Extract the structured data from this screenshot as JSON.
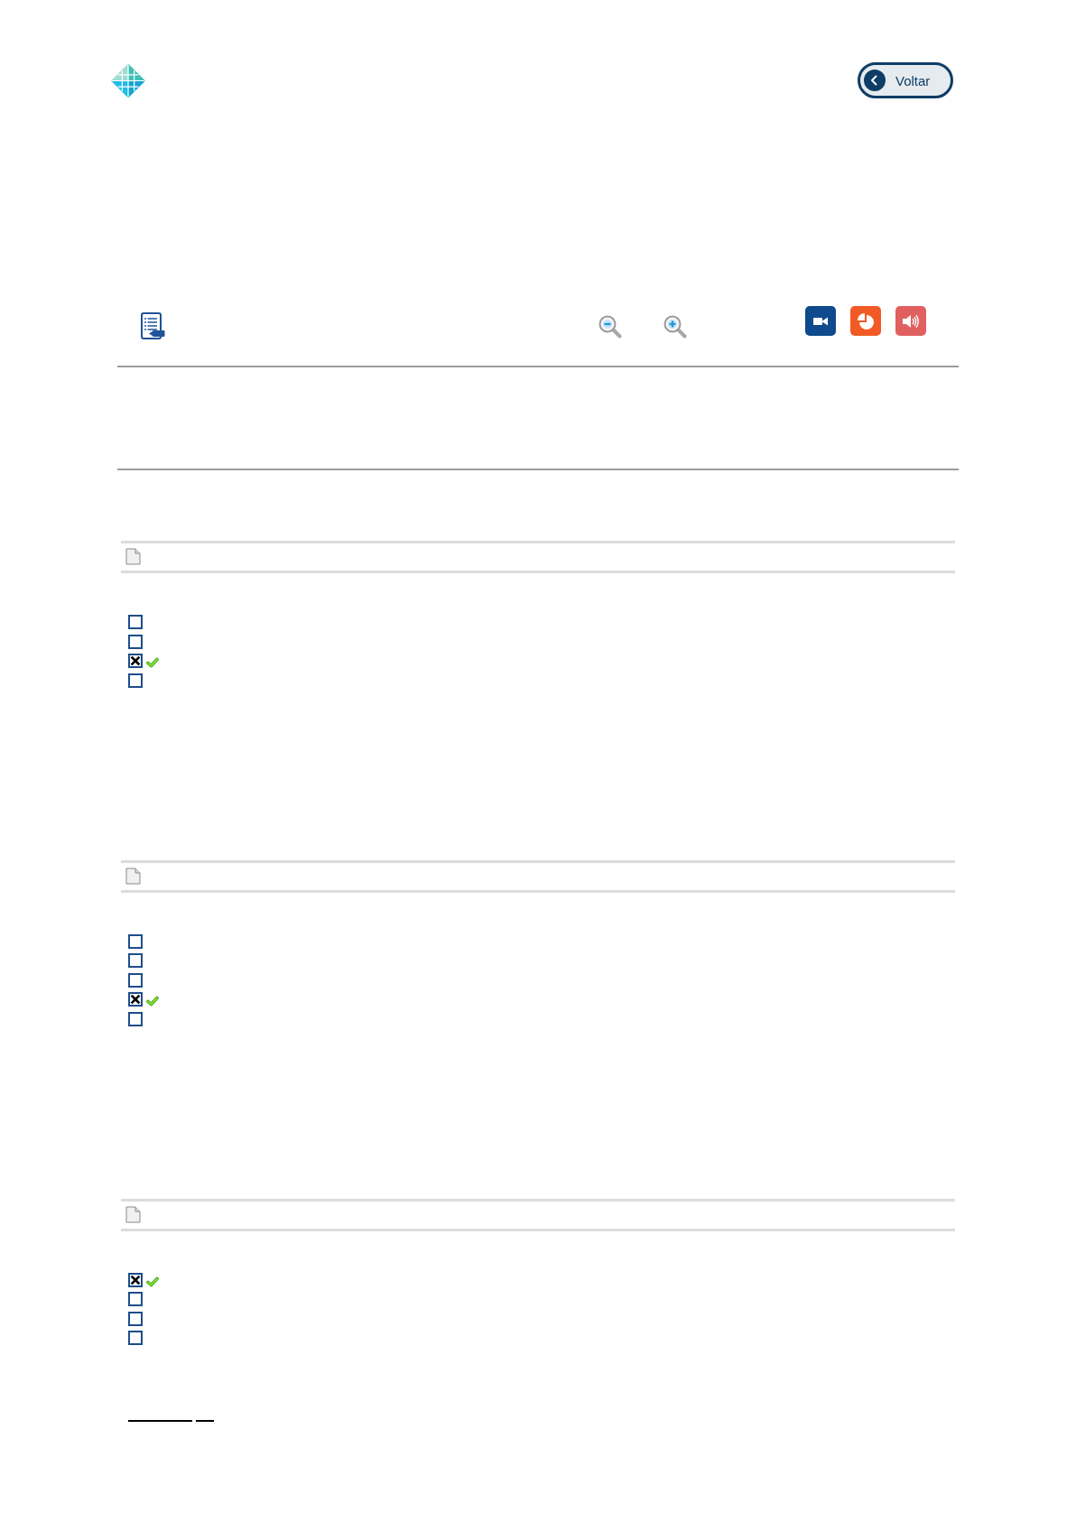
{
  "header": {
    "back_button": {
      "label": "Voltar"
    }
  },
  "questions": [
    {
      "options": [
        {
          "checked": false,
          "correct": false
        },
        {
          "checked": false,
          "correct": false
        },
        {
          "checked": true,
          "correct": true
        },
        {
          "checked": false,
          "correct": false
        }
      ]
    },
    {
      "options": [
        {
          "checked": false,
          "correct": false
        },
        {
          "checked": false,
          "correct": false
        },
        {
          "checked": false,
          "correct": false
        },
        {
          "checked": true,
          "correct": true
        },
        {
          "checked": false,
          "correct": false
        }
      ]
    },
    {
      "options": [
        {
          "checked": true,
          "correct": true
        },
        {
          "checked": false,
          "correct": false
        },
        {
          "checked": false,
          "correct": false
        },
        {
          "checked": false,
          "correct": false
        }
      ]
    }
  ]
}
